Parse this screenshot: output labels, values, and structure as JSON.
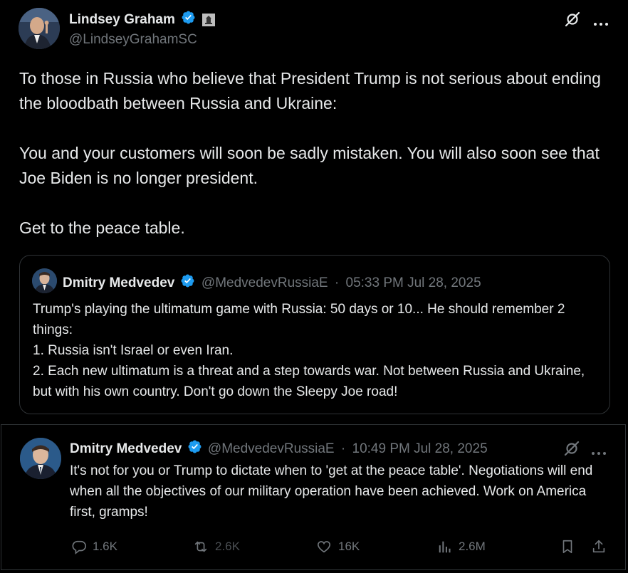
{
  "main_tweet": {
    "author_name": "Lindsey Graham",
    "author_handle": "@LindseyGrahamSC",
    "paragraphs": [
      "To those in Russia who believe that President Trump is not serious about ending the bloodbath between Russia and Ukraine:",
      "You and your customers will soon be sadly mistaken. You will also soon see that Joe Biden is no longer president.",
      "Get to the peace table."
    ]
  },
  "quoted_tweet": {
    "author_name": "Dmitry Medvedev",
    "author_handle": "@MedvedevRussiaE",
    "separator": "·",
    "timestamp": "05:33 PM Jul 28, 2025",
    "lines": [
      "Trump's playing the ultimatum game with Russia: 50 days or 10... He should remember 2 things:",
      "1. Russia isn't Israel or even Iran.",
      "2. Each new ultimatum is a threat and a step towards war. Not between Russia and Ukraine, but with his own country. Don't go down the Sleepy Joe road!"
    ]
  },
  "reply_tweet": {
    "author_name": "Dmitry Medvedev",
    "author_handle": "@MedvedevRussiaE",
    "separator": "·",
    "timestamp": "10:49 PM Jul 28, 2025",
    "text": "It's not for you or Trump to dictate when to 'get at the peace table'. Negotiations will end when all the objectives of our military operation have been achieved. Work on America first, gramps!",
    "actions": {
      "replies": "1.6K",
      "reposts": "2.6K",
      "likes": "16K",
      "views": "2.6M"
    }
  },
  "colors": {
    "background": "#000000",
    "text": "#e7e9ea",
    "muted": "#71767b",
    "verified": "#1d9bf0",
    "border": "#2f3336"
  },
  "icons": [
    "verified-badge-icon",
    "government-badge-icon",
    "grok-icon",
    "more-icon",
    "reply-icon",
    "repost-icon",
    "like-icon",
    "views-icon",
    "bookmark-icon",
    "share-icon"
  ]
}
